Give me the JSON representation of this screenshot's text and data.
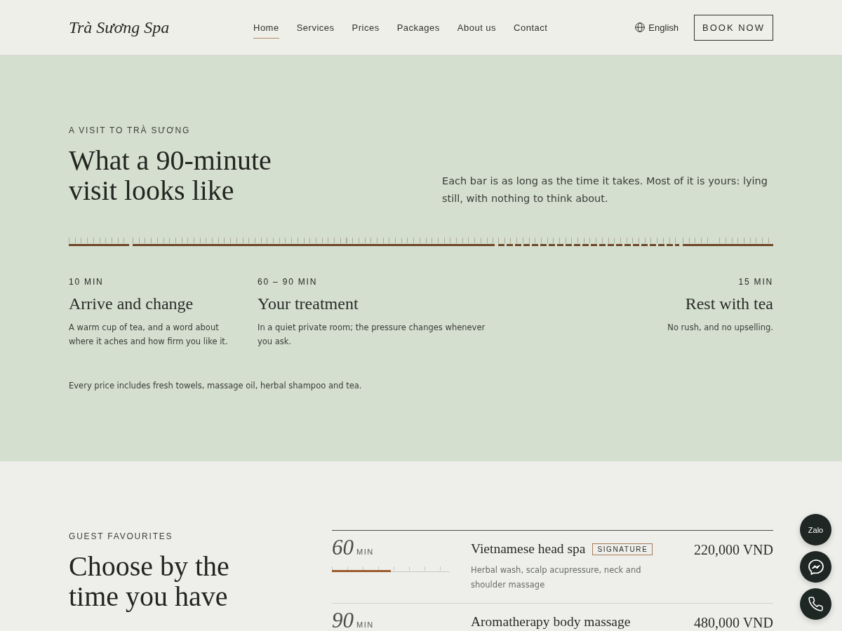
{
  "header": {
    "logo": "Trà Sương Spa",
    "nav": [
      {
        "label": "Home",
        "selected": true
      },
      {
        "label": "Services",
        "selected": false
      },
      {
        "label": "Prices",
        "selected": false
      },
      {
        "label": "Packages",
        "selected": false
      },
      {
        "label": "About us",
        "selected": false
      },
      {
        "label": "Contact",
        "selected": false
      }
    ],
    "language": "English",
    "cta": "BOOK NOW"
  },
  "visit": {
    "eyebrow": "A VISIT TO TRÀ SƯƠNG",
    "title": "What a 90-minute visit looks like",
    "intro": "Each bar is as long as the time it takes. Most of it is yours: lying still, with nothing to think about.",
    "steps": [
      {
        "duration": "10 MIN",
        "title": "Arrive and change",
        "text": "A warm cup of tea, and a word about where it aches and how firm you like it."
      },
      {
        "duration": "60 – 90 MIN",
        "title": "Your treatment",
        "text": "In a quiet private room; the pressure changes whenever you ask."
      },
      {
        "duration": "15 MIN",
        "title": "Rest with tea",
        "text": "No rush, and no upselling."
      }
    ],
    "note": "Every price includes fresh towels, massage oil, herbal shampoo and tea."
  },
  "favourites": {
    "eyebrow": "GUEST FAVOURITES",
    "title": "Choose by the time you have",
    "treatments": [
      {
        "minutes": "60",
        "unit": "MIN",
        "level": 0.5,
        "name": "Vietnamese head spa",
        "badge": "SIGNATURE",
        "description": "Herbal wash, scalp acupressure, neck and shoulder massage",
        "price": "220,000 VND"
      },
      {
        "minutes": "90",
        "unit": "MIN",
        "name": "Aromatherapy body massage",
        "price": "480,000 VND"
      }
    ]
  },
  "contact_buttons": [
    {
      "kind": "text",
      "label": "Zalo"
    },
    {
      "kind": "chat"
    },
    {
      "kind": "phone"
    }
  ]
}
